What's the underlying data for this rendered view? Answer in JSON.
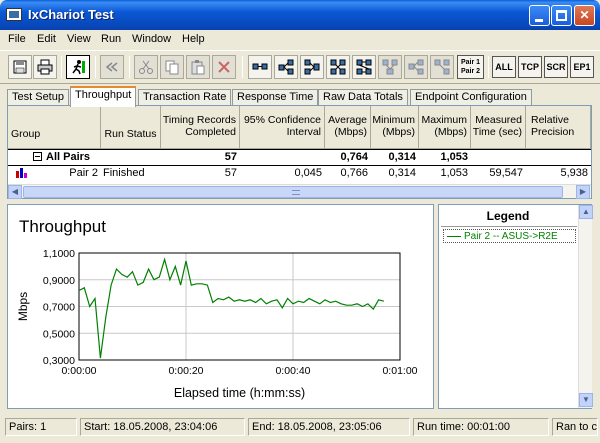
{
  "window": {
    "title": "IxChariot Test",
    "min_label": "_",
    "close_label": "✕"
  },
  "menu": [
    "File",
    "Edit",
    "View",
    "Run",
    "Window",
    "Help"
  ],
  "toolbar": {
    "pair_label_1": "Pair 1",
    "pair_label_2": "Pair 2",
    "text_buttons": [
      "ALL",
      "TCP",
      "SCR",
      "EP1"
    ]
  },
  "tabs": [
    {
      "label": "Test Setup",
      "active": false
    },
    {
      "label": "Throughput",
      "active": true
    },
    {
      "label": "Transaction Rate",
      "active": false
    },
    {
      "label": "Response Time",
      "active": false
    },
    {
      "label": "Raw Data Totals",
      "active": false
    },
    {
      "label": "Endpoint Configuration",
      "active": false
    }
  ],
  "table": {
    "headers": {
      "group": "Group",
      "run_status": "Run Status",
      "timing_1": "Timing Records",
      "timing_2": "Completed",
      "ci_1": "95% Confidence",
      "ci_2": "Interval",
      "avg_1": "Average",
      "avg_2": "(Mbps)",
      "min_1": "Minimum",
      "min_2": "(Mbps)",
      "max_1": "Maximum",
      "max_2": "(Mbps)",
      "time_1": "Measured",
      "time_2": "Time (sec)",
      "rel_1": "Relative",
      "rel_2": "Precision"
    },
    "summary": {
      "group": "All Pairs",
      "records": "57",
      "average": "0,764",
      "minimum": "0,314",
      "maximum": "1,053"
    },
    "row": {
      "group": "Pair 2",
      "status": "Finished",
      "records": "57",
      "ci": "0,045",
      "average": "0,766",
      "minimum": "0,314",
      "maximum": "1,053",
      "time": "59,547",
      "precision": "5,938"
    }
  },
  "chart": {
    "title": "Throughput",
    "xlabel": "Elapsed time (h:mm:ss)",
    "ylabel": "Mbps"
  },
  "legend": {
    "title": "Legend",
    "item": "Pair 2 -- ASUS->R2E"
  },
  "status": {
    "pairs": "Pairs: 1",
    "start": "Start: 18.05.2008, 23:04:06",
    "end": "End: 18.05.2008, 23:05:06",
    "run_time": "Run time: 00:01:00",
    "ran_to": "Ran to c"
  },
  "colors": {
    "series": "#008000",
    "titlebar": "#0a58d4",
    "active_tab_accent": "#e68b2c"
  },
  "chart_data": {
    "type": "line",
    "title": "Throughput",
    "xlabel": "Elapsed time (h:mm:ss)",
    "ylabel": "Mbps",
    "xlim": [
      0,
      60
    ],
    "ylim": [
      0.3,
      1.1
    ],
    "xticks": [
      "0:00:00",
      "0:00:20",
      "0:00:40",
      "0:01:00"
    ],
    "yticks": [
      "0,3000",
      "0,5000",
      "0,7000",
      "0,9000",
      "1,1000"
    ],
    "grid": true,
    "series": [
      {
        "name": "Pair 2 -- ASUS->R2E",
        "color": "#008000",
        "x": [
          0,
          1,
          2,
          3,
          4,
          5,
          6,
          7,
          8,
          9,
          10,
          11,
          12,
          13,
          14,
          15,
          16,
          17,
          18,
          19,
          20,
          21,
          22,
          23,
          24,
          25,
          26,
          27,
          28,
          29,
          30,
          31,
          32,
          33,
          34,
          35,
          36,
          37,
          38,
          39,
          40,
          41,
          42,
          43,
          44,
          45,
          46,
          47,
          48,
          49,
          50,
          51,
          52,
          53,
          54,
          55,
          56,
          57
        ],
        "y": [
          0.82,
          0.84,
          0.7,
          0.76,
          0.314,
          0.62,
          0.86,
          0.98,
          0.94,
          0.92,
          0.96,
          0.86,
          0.88,
          0.98,
          0.9,
          0.92,
          1.053,
          0.9,
          1.0,
          0.86,
          1.04,
          0.86,
          0.87,
          0.87,
          0.86,
          0.73,
          0.76,
          0.75,
          0.77,
          0.74,
          0.75,
          0.74,
          0.75,
          0.73,
          0.76,
          0.72,
          0.74,
          0.75,
          0.69,
          0.76,
          0.72,
          0.74,
          0.73,
          0.76,
          0.74,
          0.72,
          0.75,
          0.73,
          0.74,
          0.72,
          0.71,
          0.71,
          0.72,
          0.7,
          0.72,
          0.68,
          0.75,
          0.74
        ]
      }
    ]
  }
}
